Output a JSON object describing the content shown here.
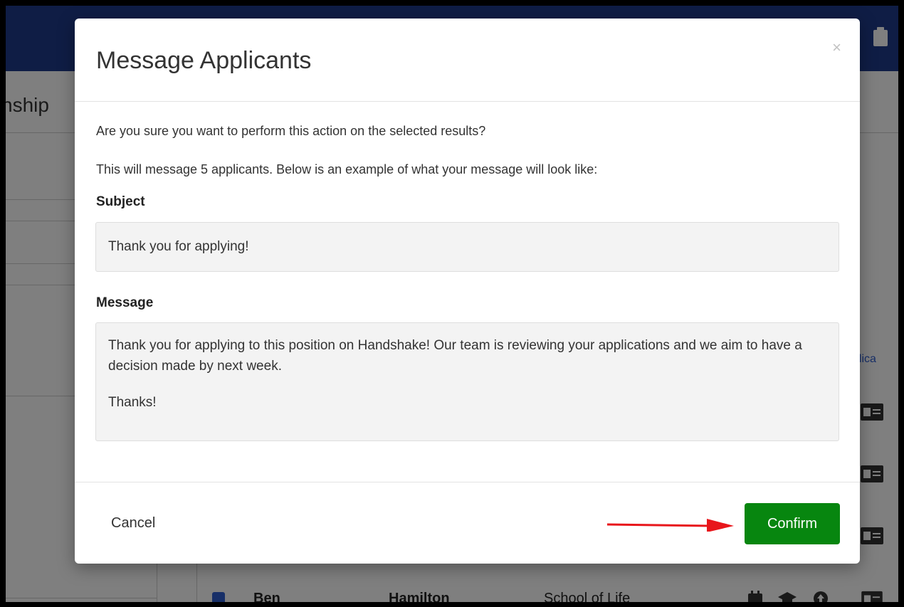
{
  "background": {
    "page_title_fragment": "nship",
    "applicants_link_fragment": "plica",
    "row": {
      "first_name": "Ben",
      "last_name": "Hamilton",
      "school": "School of Life"
    },
    "colors": {
      "topbar": "#1e3a8a",
      "link": "#2f5fd0"
    }
  },
  "modal": {
    "title": "Message Applicants",
    "close_label": "×",
    "confirm_question": "Are you sure you want to perform this action on the selected results?",
    "description": "This will message 5 applicants. Below is an example of what your message will look like:",
    "subject_label": "Subject",
    "subject_value": "Thank you for applying!",
    "message_label": "Message",
    "message_line1": "Thank you for applying to this position on Handshake! Our team is reviewing your applications and we aim to have a decision made by next week.",
    "message_line2": "Thanks!",
    "cancel_label": "Cancel",
    "confirm_label": "Confirm",
    "colors": {
      "confirm": "#07860f",
      "annotation_arrow": "#e8161b"
    }
  }
}
